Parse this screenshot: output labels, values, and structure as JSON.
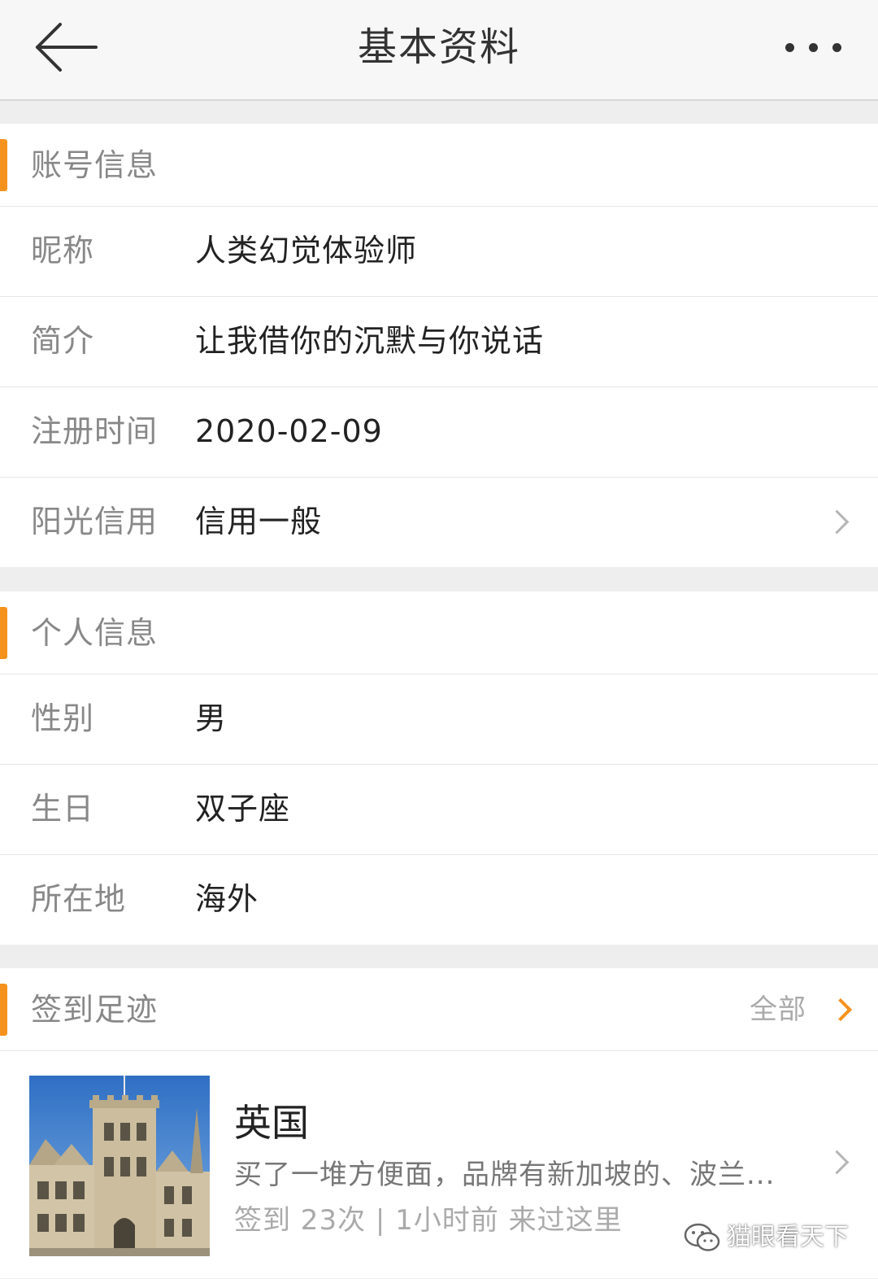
{
  "header": {
    "title": "基本资料"
  },
  "account_info": {
    "title": "账号信息",
    "rows": [
      {
        "label": "昵称",
        "value": "人类幻觉体验师"
      },
      {
        "label": "简介",
        "value": "让我借你的沉默与你说话"
      },
      {
        "label": "注册时间",
        "value": "2020-02-09"
      },
      {
        "label": "阳光信用",
        "value": "信用一般"
      }
    ]
  },
  "personal_info": {
    "title": "个人信息",
    "rows": [
      {
        "label": "性别",
        "value": "男"
      },
      {
        "label": "生日",
        "value": "双子座"
      },
      {
        "label": "所在地",
        "value": "海外"
      }
    ]
  },
  "checkins": {
    "title": "签到足迹",
    "all_label": "全部",
    "item": {
      "place": "英国",
      "description": "买了一堆方便面，品牌有新加坡的、波兰...",
      "meta": "签到 23次 | 1小时前 来过这里"
    }
  },
  "watermark": {
    "text": "猫眼看天下"
  },
  "colors": {
    "accent": "#f5921e",
    "background": "#eeeeee",
    "header_bg": "#f7f7f7"
  },
  "icons": {
    "back": "back-arrow-icon",
    "more": "more-icon",
    "chevron": "chevron-right-icon",
    "watermark": "wechat-icon"
  }
}
